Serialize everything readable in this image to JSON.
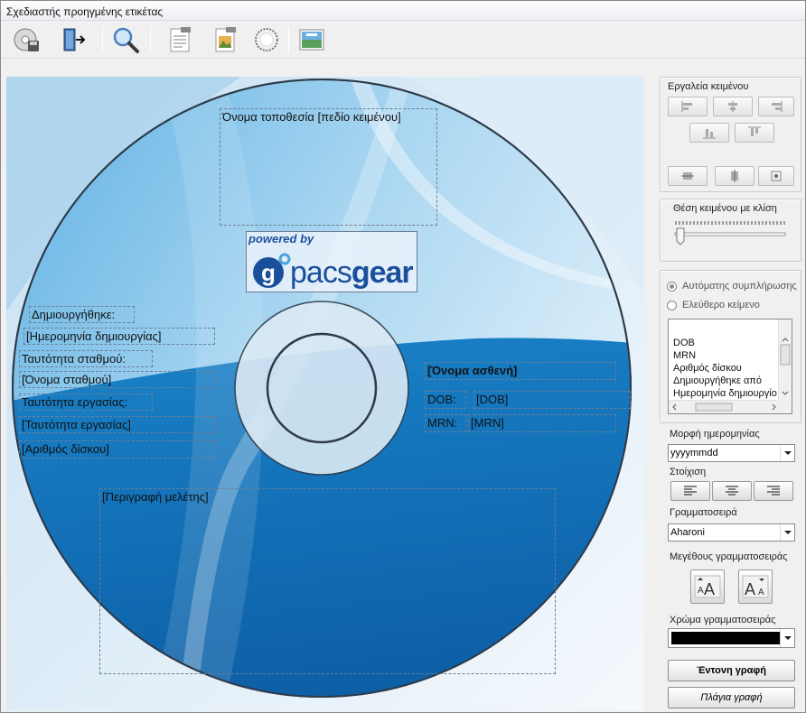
{
  "window": {
    "title": "Σχεδιαστής προηγμένης ετικέτας"
  },
  "toolbar": {
    "buttons": [
      {
        "icon": "save-disc-icon"
      },
      {
        "icon": "exit-door-icon"
      },
      {
        "icon": "magnifier-icon"
      },
      {
        "icon": "text-document-icon"
      },
      {
        "icon": "image-document-icon"
      },
      {
        "icon": "circular-text-icon"
      },
      {
        "icon": "background-image-icon"
      }
    ]
  },
  "canvas": {
    "fields": {
      "site_name": "Όνομα τοποθεσία [πεδίο κειμένου]",
      "created_label": "Δημιουργήθηκε:",
      "created_date": "[Ημερομηνία δημιουργίας]",
      "station_label": "Ταυτότητα σταθμού:",
      "station_name": "[Όνομα σταθμού]",
      "job_label": "Ταυτότητα εργασίας:",
      "job_id": "[Ταυτότητα εργασίας]",
      "disc_number": "[Αριθμός δίσκου]",
      "patient_name": "[Όνομα ασθενή]",
      "dob_label": "DOB:",
      "dob_value": "[DOB]",
      "mrn_label": "MRN:",
      "mrn_value": "[MRN]",
      "study_desc": "[Περιγραφή μελέτης]"
    },
    "logo": {
      "powered_by": "powered by",
      "brand_light": "pacs",
      "brand_bold": "gear",
      "badge": "g"
    }
  },
  "panel": {
    "text_tools_title": "Εργαλεία κειμένου",
    "text_position_title": "Θέση κειμένου με κλίση",
    "slider_value": 0,
    "radio_auto": "Αυτόματης συμπλήρωσης",
    "radio_free": "Ελεύθερο κείμενο",
    "radio_selected": "auto",
    "list_items": [
      "DOB",
      "MRN",
      "Αριθμός δίσκου",
      "Δημιουργήθηκε από",
      "Ημερομηνία δημιουργίο"
    ],
    "date_format_label": "Μορφή ημερομηνίας",
    "date_format_value": "yyyymmdd",
    "alignment_label": "Στοίχιση",
    "font_label": "Γραμματοσειρά",
    "font_value": "Aharoni",
    "font_size_label": "Μεγέθους γραμματοσειράς",
    "font_color_label": "Χρώμα γραμματοσειράς",
    "font_color": "#000000",
    "bold_button": "Έντονη γραφή",
    "italic_button": "Πλάγια γραφή"
  }
}
